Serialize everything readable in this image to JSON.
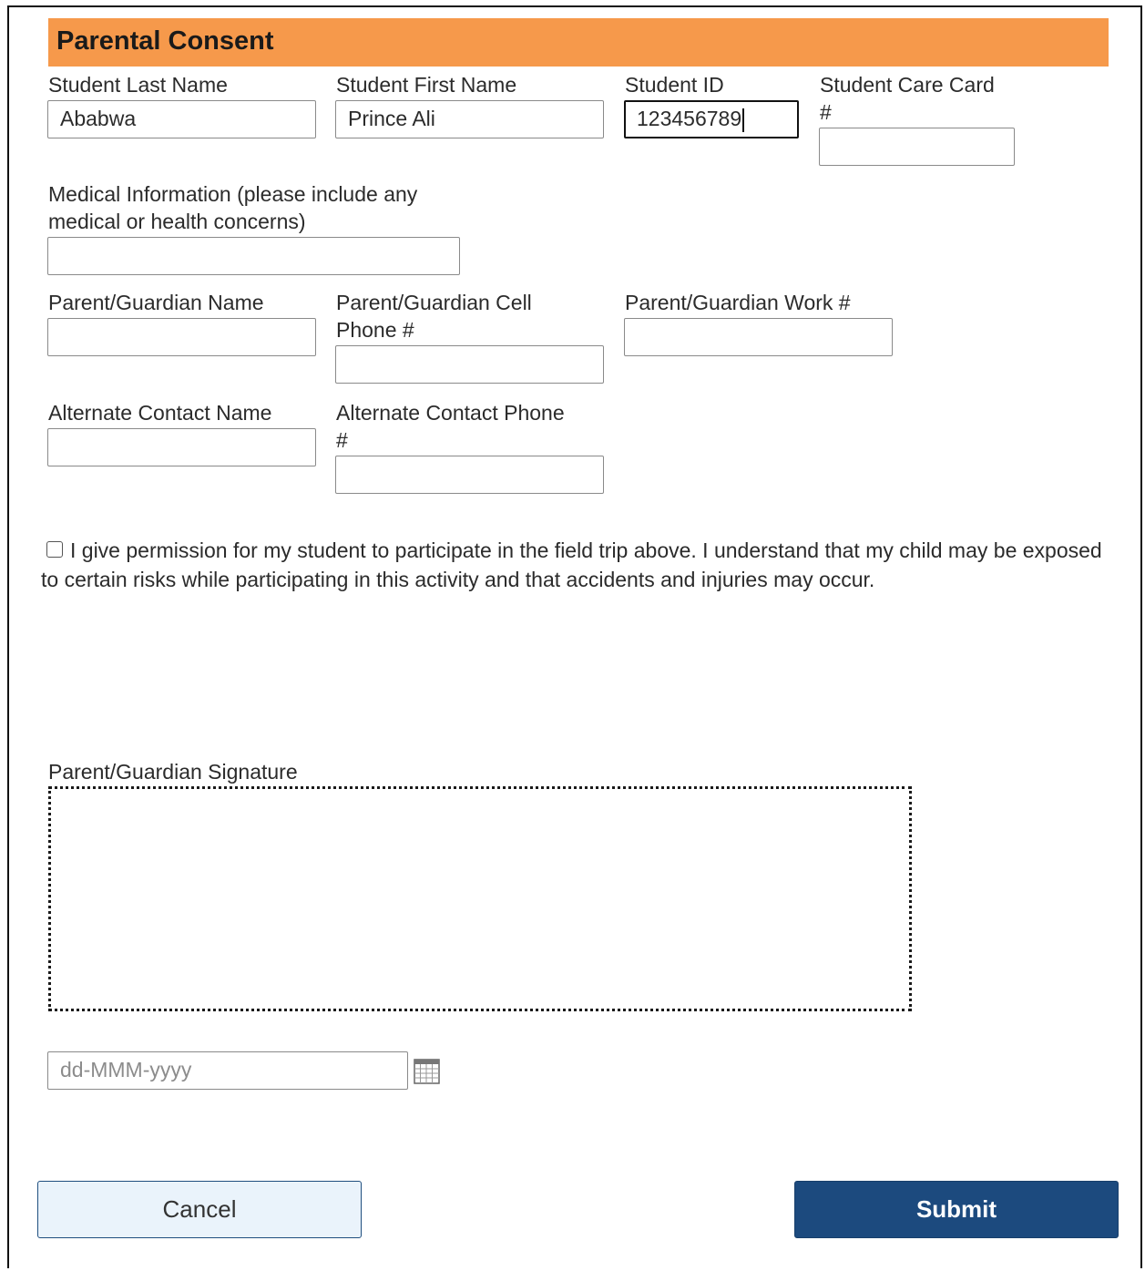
{
  "header": {
    "title": "Parental Consent"
  },
  "fields": {
    "student_last_name": {
      "label": "Student Last Name",
      "value": "Ababwa"
    },
    "student_first_name": {
      "label": "Student First Name",
      "value": "Prince Ali"
    },
    "student_id": {
      "label": "Student ID",
      "value": "123456789"
    },
    "student_care_card": {
      "label_line1": "Student Care Card",
      "label_line2": "#",
      "value": ""
    },
    "medical_info": {
      "label_line1": "Medical Information (please include any",
      "label_line2": "medical or health concerns)",
      "value": ""
    },
    "parent_name": {
      "label": "Parent/Guardian Name",
      "value": ""
    },
    "parent_cell": {
      "label_line1": "Parent/Guardian Cell",
      "label_line2": "Phone #",
      "value": ""
    },
    "parent_work": {
      "label": "Parent/Guardian Work #",
      "value": ""
    },
    "alt_contact_name": {
      "label": "Alternate Contact Name",
      "value": ""
    },
    "alt_contact_phone": {
      "label_line1": "Alternate Contact Phone",
      "label_line2": "#",
      "value": ""
    }
  },
  "consent": {
    "checked": false,
    "text": "I give permission for my student to participate in the field trip above. I understand that my child may be exposed to certain risks while participating in this activity and that accidents and injuries may occur."
  },
  "signature": {
    "label": "Parent/Guardian Signature"
  },
  "date": {
    "placeholder": "dd-MMM-yyyy",
    "value": ""
  },
  "actions": {
    "cancel_label": "Cancel",
    "submit_label": "Submit"
  },
  "colors": {
    "header": "#f6994b",
    "submit": "#1c4a7e",
    "cancel_bg": "#eaf3fb"
  }
}
